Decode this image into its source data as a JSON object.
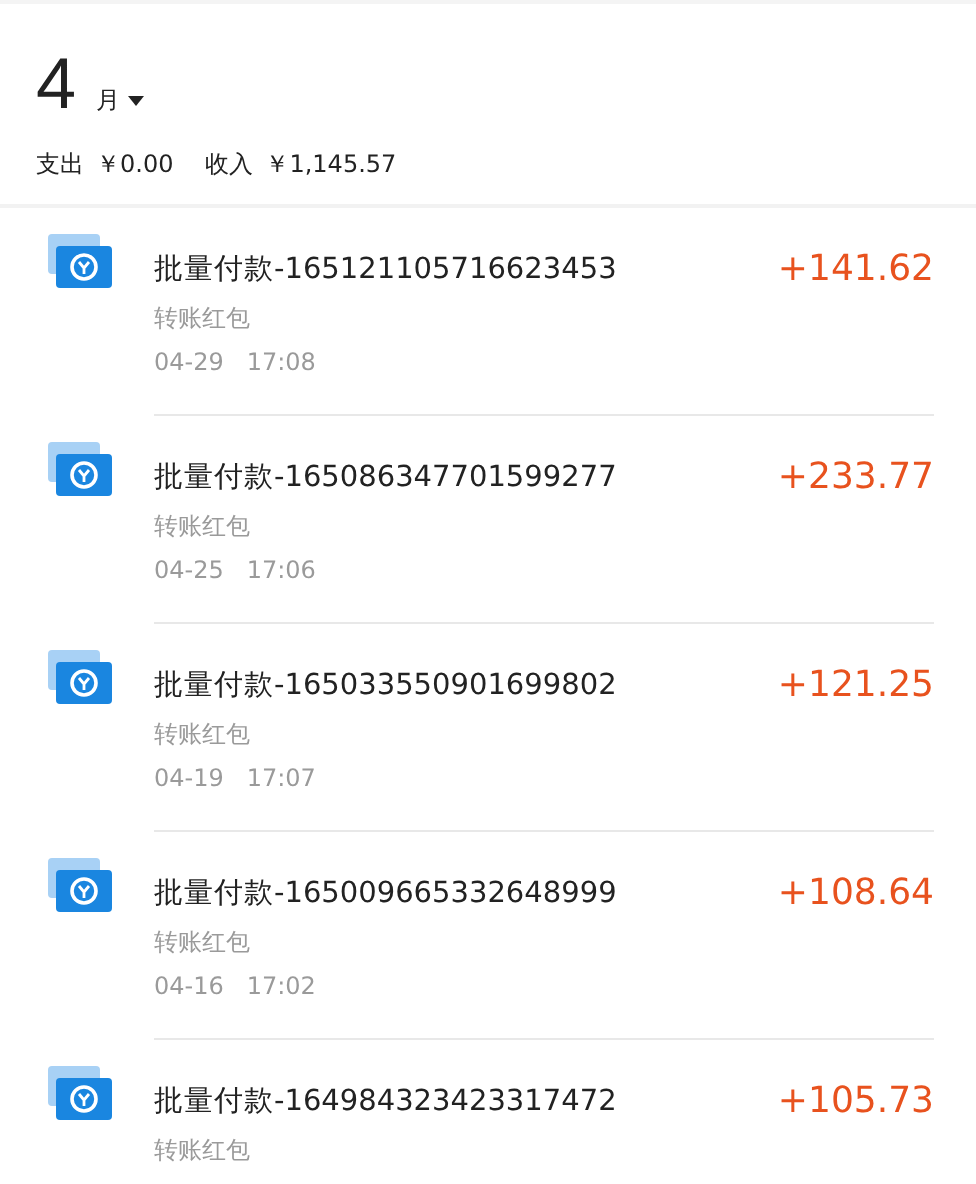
{
  "header": {
    "month": "4",
    "month_unit": "月",
    "summary": [
      {
        "label": "支出",
        "amount": "￥0.00"
      },
      {
        "label": "收入",
        "amount": "￥1,145.57"
      }
    ]
  },
  "transactions": [
    {
      "title": "批量付款-165121105716623453",
      "category": "转账红包",
      "date": "04-29",
      "time": "17:08",
      "amount": "+141.62"
    },
    {
      "title": "批量付款-165086347701599277",
      "category": "转账红包",
      "date": "04-25",
      "time": "17:06",
      "amount": "+233.77"
    },
    {
      "title": "批量付款-165033550901699802",
      "category": "转账红包",
      "date": "04-19",
      "time": "17:07",
      "amount": "+121.25"
    },
    {
      "title": "批量付款-165009665332648999",
      "category": "转账红包",
      "date": "04-16",
      "time": "17:02",
      "amount": "+108.64"
    },
    {
      "title": "批量付款-164984323423317472",
      "category": "转账红包",
      "amount": "+105.73"
    }
  ]
}
